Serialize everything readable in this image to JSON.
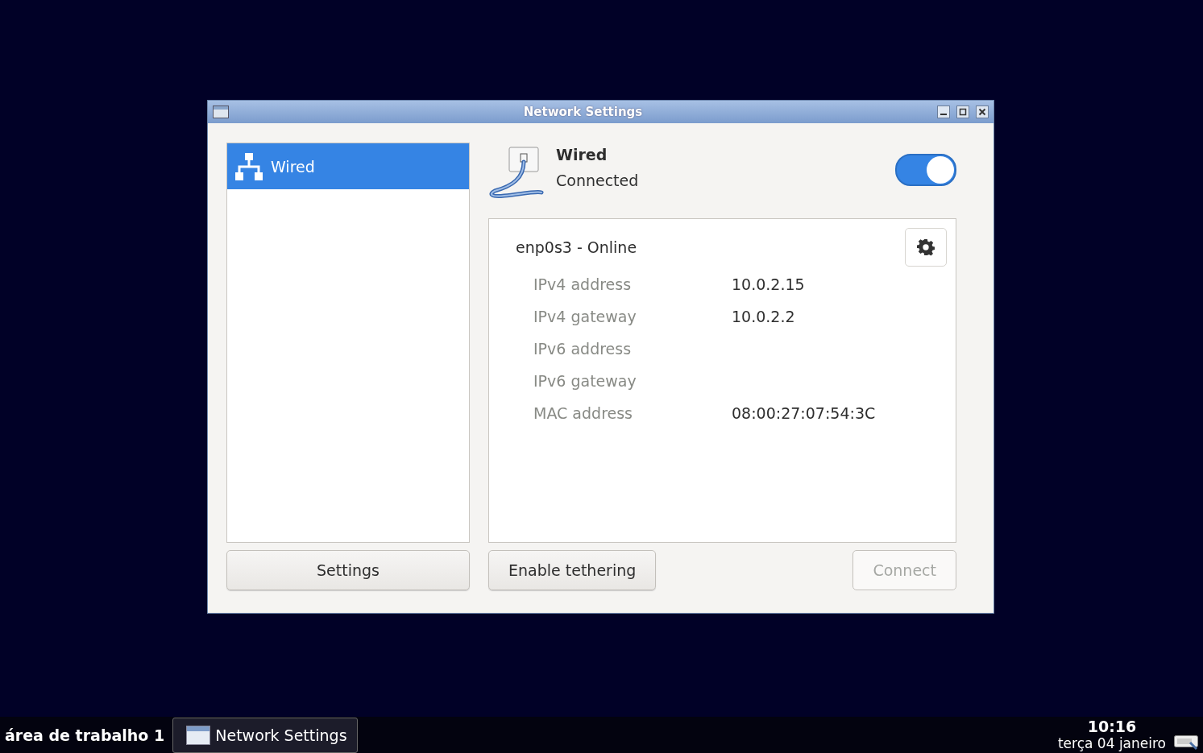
{
  "window": {
    "title": "Network Settings"
  },
  "sidebar": {
    "items": [
      {
        "label": "Wired",
        "selected": true
      }
    ]
  },
  "device": {
    "name": "Wired",
    "status": "Connected",
    "on": true
  },
  "connection": {
    "title": "enp0s3 - Online",
    "details": [
      {
        "label": "IPv4 address",
        "value": "10.0.2.15"
      },
      {
        "label": "IPv4 gateway",
        "value": "10.0.2.2"
      },
      {
        "label": "IPv6 address"
      },
      {
        "label": "IPv6 gateway"
      },
      {
        "label": "MAC address",
        "value": "08:00:27:07:54:3C"
      }
    ]
  },
  "buttons": {
    "settings": {
      "label": "Settings",
      "disabled": false
    },
    "tethering": {
      "label": "Enable tethering",
      "disabled": false
    },
    "connect": {
      "label": "Connect",
      "disabled": true
    }
  },
  "taskbar": {
    "workspace": "área de trabalho 1",
    "tasks": [
      {
        "label": "Network Settings",
        "selected": true
      }
    ],
    "time": "10:16",
    "date": "terça 04 janeiro"
  }
}
